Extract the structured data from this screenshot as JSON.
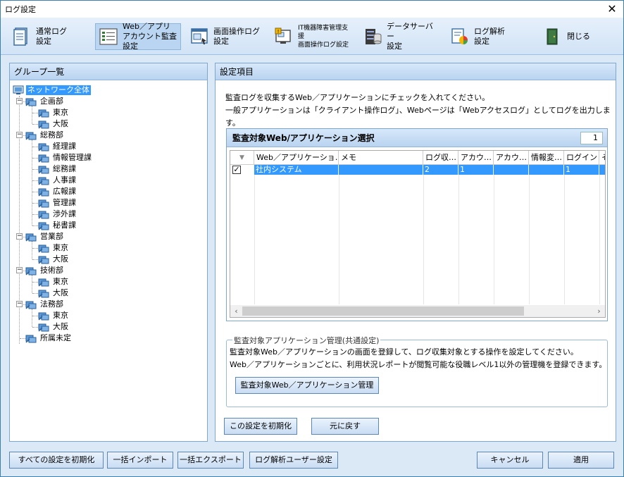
{
  "window": {
    "title": "ログ設定",
    "close_glyph": "✕"
  },
  "toolbar": {
    "items": [
      {
        "label": "通常ログ\n設定",
        "icon": "document-icon"
      },
      {
        "label": "Web／アプリ\nアカウント監査設定",
        "icon": "list-icon",
        "active": true
      },
      {
        "label": "画面操作ログ\n設定",
        "icon": "screen-icon"
      },
      {
        "label": "IT機器障害管理支援\n画面操作ログ設定",
        "icon": "screen-alert-icon"
      },
      {
        "label": "データサーバー\n設定",
        "icon": "database-icon"
      },
      {
        "label": "ログ解析\n設定",
        "icon": "chart-icon"
      },
      {
        "label": "閉じる",
        "icon": "exit-icon"
      }
    ]
  },
  "left_panel": {
    "title": "グループ一覧",
    "tree": [
      {
        "label": "ネットワーク全体",
        "level": 0,
        "selected": true
      },
      {
        "label": "企画部",
        "level": 1,
        "expander": "−"
      },
      {
        "label": "東京",
        "level": 2
      },
      {
        "label": "大阪",
        "level": 2
      },
      {
        "label": "総務部",
        "level": 1,
        "expander": "−"
      },
      {
        "label": "経理課",
        "level": 2
      },
      {
        "label": "情報管理課",
        "level": 2
      },
      {
        "label": "総務課",
        "level": 2
      },
      {
        "label": "人事課",
        "level": 2
      },
      {
        "label": "広報課",
        "level": 2
      },
      {
        "label": "管理課",
        "level": 2
      },
      {
        "label": "渉外課",
        "level": 2
      },
      {
        "label": "秘書課",
        "level": 2
      },
      {
        "label": "営業部",
        "level": 1,
        "expander": "−"
      },
      {
        "label": "東京",
        "level": 2
      },
      {
        "label": "大阪",
        "level": 2
      },
      {
        "label": "技術部",
        "level": 1,
        "expander": "−"
      },
      {
        "label": "東京",
        "level": 2
      },
      {
        "label": "大阪",
        "level": 2
      },
      {
        "label": "法務部",
        "level": 1,
        "expander": "−"
      },
      {
        "label": "東京",
        "level": 2
      },
      {
        "label": "大阪",
        "level": 2
      },
      {
        "label": "所属未定",
        "level": 1
      }
    ]
  },
  "right_panel": {
    "title": "設定項目",
    "info_line1": "監査ログを収集するWeb／アプリケーションにチェックを入れてください。",
    "info_line2": "一般アプリケーションは「クライアント操作ログ」、Webページは「Webアクセスログ」としてログを出力します。",
    "grid": {
      "title": "監査対象Web/アプリケーション選択",
      "count": "1",
      "sort_glyph": "▼",
      "columns": [
        "Web／アプリケーショ…",
        "メモ",
        "ログ収…",
        "アカウ…",
        "アカウ…",
        "情報変…",
        "ログイン",
        "そ"
      ],
      "rows": [
        {
          "checked": true,
          "cells": [
            "社内システム",
            "",
            "2",
            "1",
            "",
            "",
            "1",
            ""
          ]
        }
      ],
      "scroll_left": "‹",
      "scroll_right": "›"
    },
    "group": {
      "legend": "監査対象アプリケーション管理(共通設定)",
      "text1": "監査対象Web／アプリケーションの画面を登録して、ログ収集対象とする操作を設定してください。",
      "text2": "Web／アプリケーションごとに、利用状況レポートが閲覧可能な役職レベル1以外の管理機を登録できます。",
      "button": "監査対象Web／アプリケーション管理"
    },
    "reset_button": "この設定を初期化",
    "revert_button": "元に戻す"
  },
  "footer": {
    "reset_all": "すべての設定を初期化",
    "import": "一括インポート",
    "export": "一括エクスポート",
    "log_user": "ログ解析ユーザー設定",
    "cancel": "キャンセル",
    "apply": "適用"
  },
  "colors": {
    "accent": "#3399ff",
    "panel_border": "#7ea7cf",
    "background": "#dbe8f5"
  }
}
